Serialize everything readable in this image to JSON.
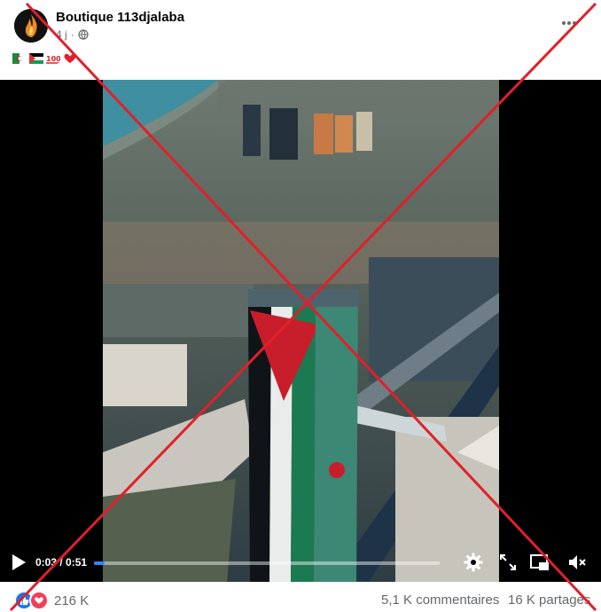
{
  "post": {
    "page_name": "Boutique 113djalaba",
    "time_ago": "4 j",
    "separator": "·",
    "audience_icon": "globe-icon",
    "text_emojis": [
      "algeria-flag-emoji",
      "palestine-flag-emoji",
      "hundred-points-emoji",
      "red-heart-emoji"
    ]
  },
  "video": {
    "current_time": "0:03",
    "duration": "0:51",
    "time_display": "0:03 / 0:51",
    "progress": 0.03,
    "scene": "aerial view of a tower painted with the Palestinian flag",
    "icons": [
      "play-icon",
      "settings-icon",
      "fullscreen-icon",
      "picture-in-picture-icon",
      "mute-icon"
    ]
  },
  "overlay": {
    "mark": "red-cross",
    "color": "#e0202a"
  },
  "stats": {
    "reactions_count": "216 K",
    "comments": "5,1 K commentaires",
    "shares": "16 K partages",
    "reaction_icons": [
      "like-icon",
      "love-icon"
    ]
  },
  "colors": {
    "accent": "#2d88ff",
    "like": "#1877f2",
    "love": "#f33e58",
    "secondary_text": "#65676b"
  }
}
